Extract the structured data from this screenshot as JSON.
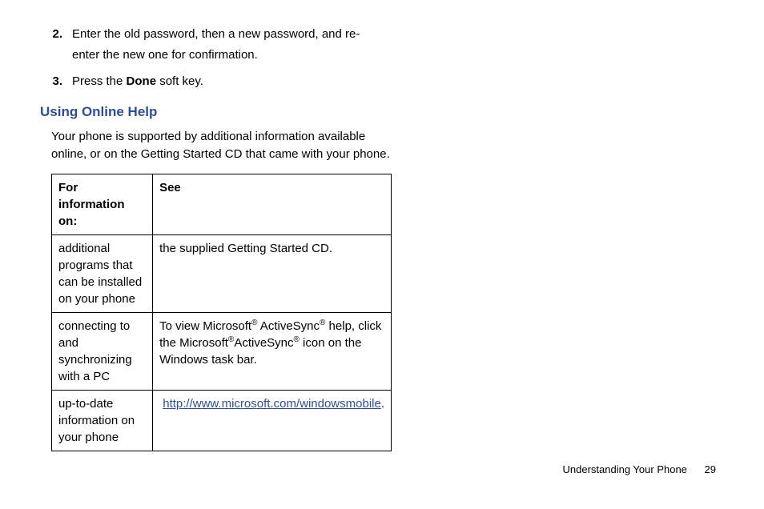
{
  "steps": [
    {
      "num": "2.",
      "text_a": "Enter the old password, then a new password, and re-enter the new one for confirmation."
    },
    {
      "num": "3.",
      "text_a": "Press the ",
      "bold": "Done",
      "text_b": " soft key."
    }
  ],
  "heading": "Using Online Help",
  "intro": "Your phone is supported by additional information available online, or on the Getting Started CD that came with your phone.",
  "table": {
    "head": {
      "c1": "For information on:",
      "c2": "See"
    },
    "rows": [
      {
        "c1": "additional programs that can be installed on your phone",
        "c2": "the supplied Getting Started CD."
      },
      {
        "c1": "connecting to and synchronizing with a PC",
        "c2_parts": {
          "t1": "To view Microsoft",
          "r1": "®",
          "t2": " ActiveSync",
          "r2": "®",
          "t3": " help, click the Microsoft",
          "r3": "®",
          "t4": "ActiveSync",
          "r4": "®",
          "t5": " icon on the Windows task bar."
        }
      },
      {
        "c1": "up-to-date information on your phone",
        "link": "http://www.microsoft.com/windowsmobile",
        "after": "."
      }
    ]
  },
  "footer": {
    "section": "Understanding Your Phone",
    "page": "29"
  }
}
